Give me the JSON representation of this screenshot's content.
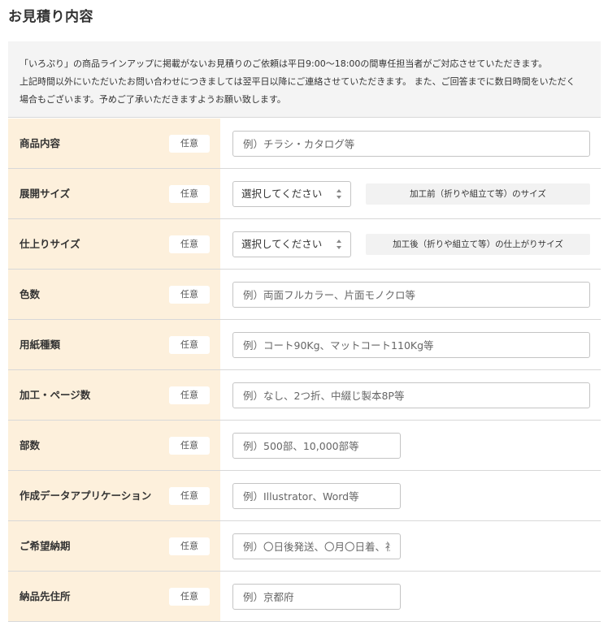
{
  "page": {
    "title": "お見積り内容"
  },
  "notice": {
    "line1": "「いろぷり」の商品ラインアップに掲載がないお見積りのご依頼は平日9:00～18:00の間専任担当者がご対応させていただきます。",
    "line2": "上記時間以外にいただいたお問い合わせにつきましては翌平日以降にご連絡させていただきます。 また、ご回答までに数日時間をいただく",
    "line3": "場合もございます。予めご了承いただきますようお願い致します。"
  },
  "badge_label": "任意",
  "fields": {
    "product": {
      "label": "商品内容",
      "placeholder": "例）チラシ・カタログ等"
    },
    "open_size": {
      "label": "展開サイズ",
      "select_value": "選択してください",
      "note": "加工前（折りや組立て等）のサイズ"
    },
    "finished_size": {
      "label": "仕上りサイズ",
      "select_value": "選択してください",
      "note": "加工後（折りや組立て等）の仕上がりサイズ"
    },
    "colors": {
      "label": "色数",
      "placeholder": "例）両面フルカラー、片面モノクロ等"
    },
    "paper": {
      "label": "用紙種類",
      "placeholder": "例）コート90Kg、マットコート110Kg等"
    },
    "processing": {
      "label": "加工・ページ数",
      "placeholder": "例）なし、2つ折、中綴じ製本8P等"
    },
    "quantity": {
      "label": "部数",
      "placeholder": "例）500部、10,000部等"
    },
    "application": {
      "label": "作成データアプリケーション",
      "placeholder": "例）Illustrator、Word等"
    },
    "delivery_date": {
      "label": "ご希望納期",
      "placeholder": "例）〇日後発送、〇月〇日着、社内稟議のため等"
    },
    "delivery_address": {
      "label": "納品先住所",
      "placeholder": "例）京都府"
    }
  },
  "colors": {
    "label_background": "#fdf0dc",
    "notice_background": "#f4f4f4",
    "border": "#d8d8d8"
  }
}
